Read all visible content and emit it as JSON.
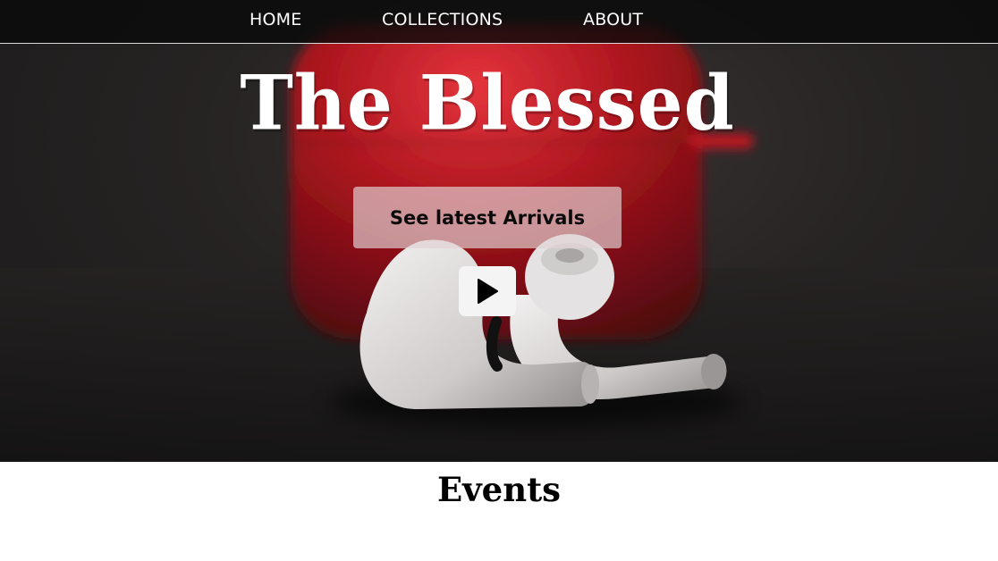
{
  "nav": {
    "items": [
      {
        "label": "HOME"
      },
      {
        "label": "COLLECTIONS"
      },
      {
        "label": "ABOUT"
      }
    ]
  },
  "hero": {
    "title": "The Blessed",
    "cta_label": "See latest Arrivals",
    "play_icon": "play-icon",
    "background_description_colors": {
      "case": "#b5141e",
      "earbuds": "#e8e6e6",
      "backdrop": "#1e1c1c"
    }
  },
  "events": {
    "title": "Events"
  },
  "colors": {
    "nav_background": "#0b0b0b",
    "nav_text": "#ffffff",
    "button_background": "#d8c8ca",
    "button_text": "#000000",
    "accent_red": "#b5141e"
  }
}
